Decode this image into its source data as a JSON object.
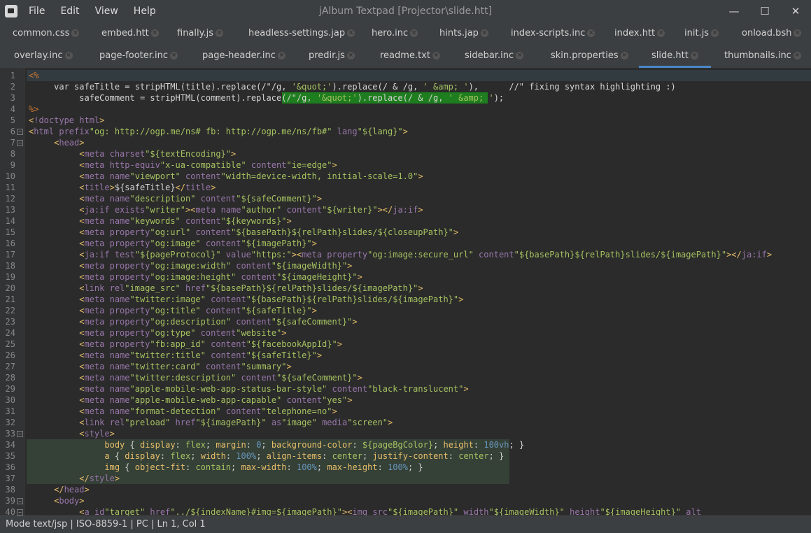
{
  "window": {
    "title": "jAlbum Textpad [Projector\\slide.htt]",
    "menu": [
      "File",
      "Edit",
      "View",
      "Help"
    ],
    "controls": {
      "minimize": "—",
      "maximize": "☐",
      "close": "✕"
    }
  },
  "tabs": {
    "row1": [
      "common.css",
      "embed.htt",
      "finally.js",
      "headless-settings.jap",
      "hero.inc",
      "hints.jap",
      "index-scripts.inc",
      "index.htt",
      "init.js",
      "onload.bsh"
    ],
    "row2": [
      "overlay.inc",
      "page-footer.inc",
      "page-header.inc",
      "predir.js",
      "readme.txt",
      "sidebar.inc",
      "skin.properties",
      "slide.htt",
      "thumbnails.inc"
    ],
    "active": "slide.htt",
    "close_glyph": "×"
  },
  "colors": {
    "tag": "#e8bf6a",
    "attr": "#9876aa",
    "string": "#a5c261",
    "scriptlet": "#cc7832",
    "text": "#d6d6d6",
    "line_number": "#888888",
    "css_selector": "#e8bf6a",
    "css_prop": "#bababa",
    "css_value": "#a5c261",
    "css_number": "#6897bb",
    "selection": "#1e7d1e",
    "active_tab": "#4a88c7"
  },
  "editor": {
    "lines": [
      {
        "n": "1",
        "t": "<%"
      },
      {
        "n": "2",
        "t": "     var safeTitle = stripHTML(title).replace(/\"/g, '&quot;').replace(/ & /g, ' &amp; '),      //\" fixing syntax highlighting :)"
      },
      {
        "n": "3",
        "t": "          safeComment = stripHTML(comment).replace(/\"/g, '&quot;').replace(/ & /g, ' &amp; ');"
      },
      {
        "n": "4",
        "t": "%>"
      },
      {
        "n": "5",
        "t": "<!doctype html>"
      },
      {
        "n": "6",
        "t": "<html prefix=\"og: http://ogp.me/ns# fb: http://ogp.me/ns/fb#\" lang=\"${lang}\">"
      },
      {
        "n": "7",
        "t": "     <head>"
      },
      {
        "n": "8",
        "t": "          <meta charset=\"${textEncoding}\">"
      },
      {
        "n": "9",
        "t": "          <meta http-equiv=\"x-ua-compatible\" content=\"ie=edge\">"
      },
      {
        "n": "10",
        "t": "          <meta name=\"viewport\" content=\"width=device-width, initial-scale=1.0\">"
      },
      {
        "n": "11",
        "t": "          <title>${safeTitle}</title>"
      },
      {
        "n": "12",
        "t": "          <meta name=\"description\" content=\"${safeComment}\">"
      },
      {
        "n": "13",
        "t": "          <ja:if exists=\"writer\"><meta name=\"author\" content=\"${writer}\"></ja:if>"
      },
      {
        "n": "14",
        "t": "          <meta name=\"keywords\" content=\"${keywords}\">"
      },
      {
        "n": "15",
        "t": "          <meta property=\"og:url\" content=\"${basePath}${relPath}slides/${closeupPath}\">"
      },
      {
        "n": "16",
        "t": "          <meta property=\"og:image\" content=\"${imagePath}\">"
      },
      {
        "n": "17",
        "t": "          <ja:if test=\"${pageProtocol}\" value=\"https:\"><meta property=\"og:image:secure_url\" content=\"${basePath}${relPath}slides/${imagePath}\"></ja:if>"
      },
      {
        "n": "18",
        "t": "          <meta property=\"og:image:width\" content=\"${imageWidth}\">"
      },
      {
        "n": "19",
        "t": "          <meta property=\"og:image:height\" content=\"${imageHeight}\">"
      },
      {
        "n": "20",
        "t": "          <link rel=\"image_src\" href=\"${basePath}${relPath}slides/${imagePath}\">"
      },
      {
        "n": "21",
        "t": "          <meta name=\"twitter:image\" content=\"${basePath}${relPath}slides/${imagePath}\">"
      },
      {
        "n": "22",
        "t": "          <meta property=\"og:title\" content=\"${safeTitle}\">"
      },
      {
        "n": "23",
        "t": "          <meta property=\"og:description\" content=\"${safeComment}\">"
      },
      {
        "n": "24",
        "t": "          <meta property=\"og:type\" content=\"website\">"
      },
      {
        "n": "25",
        "t": "          <meta property=\"fb:app_id\" content=\"${facebookAppId}\">"
      },
      {
        "n": "26",
        "t": "          <meta name=\"twitter:title\" content=\"${safeTitle}\">"
      },
      {
        "n": "27",
        "t": "          <meta name=\"twitter:card\" content=\"summary\">"
      },
      {
        "n": "28",
        "t": "          <meta name=\"twitter:description\" content=\"${safeComment}\">"
      },
      {
        "n": "29",
        "t": "          <meta name=\"apple-mobile-web-app-status-bar-style\" content=\"black-translucent\">"
      },
      {
        "n": "30",
        "t": "          <meta name=\"apple-mobile-web-app-capable\" content=\"yes\">"
      },
      {
        "n": "31",
        "t": "          <meta name=\"format-detection\" content=\"telephone=no\">"
      },
      {
        "n": "32",
        "t": "          <link rel=\"preload\" href=\"${imagePath}\" as=\"image\" media=\"screen\">"
      },
      {
        "n": "33",
        "t": "          <style>"
      },
      {
        "n": "34",
        "t": "               body { display: flex; margin: 0; background-color: ${pageBgColor}; height: 100vh; }"
      },
      {
        "n": "35",
        "t": "               a { display: flex; width: 100%; align-items: center; justify-content: center; }"
      },
      {
        "n": "36",
        "t": "               img { object-fit: contain; max-width: 100%; max-height: 100%; }"
      },
      {
        "n": "37",
        "t": "          </style>"
      },
      {
        "n": "38",
        "t": "     </head>"
      },
      {
        "n": "39",
        "t": "     <body>"
      },
      {
        "n": "40",
        "t": "          <a id=\"target\" href=\"../${indexName}#img=${imagePath}\"><img src=\"${imagePath}\" width=\"${imageWidth}\" height=\"${imageHeight}\" alt="
      }
    ],
    "fold_lines": [
      "6",
      "7",
      "33",
      "39",
      "40"
    ],
    "style_block_lines": [
      "34",
      "35",
      "36",
      "37"
    ],
    "fold_glyph": "−"
  },
  "status": {
    "text": "Mode text/jsp | ISO-8859-1 | PC | Ln 1, Col 1"
  }
}
